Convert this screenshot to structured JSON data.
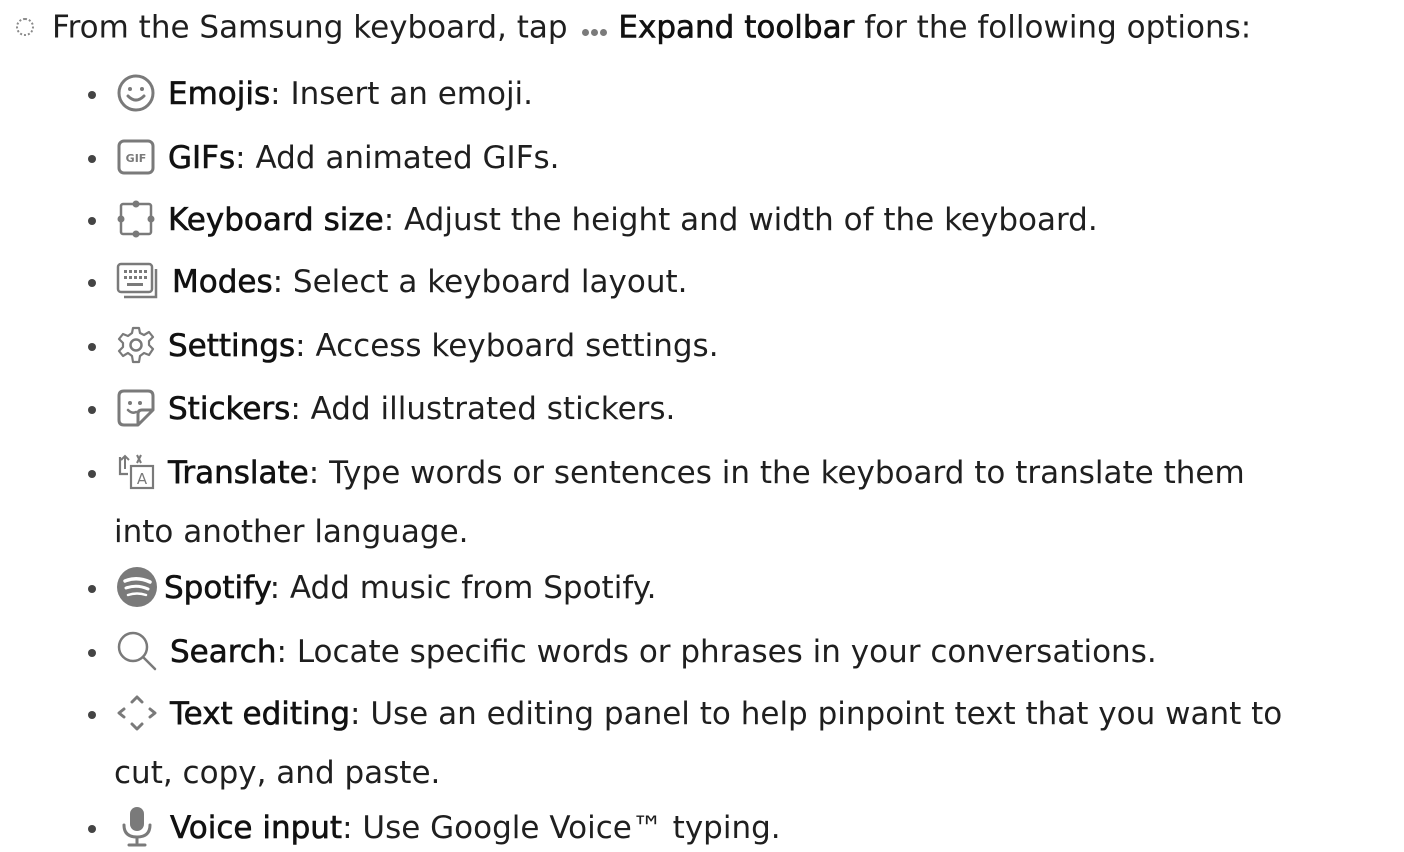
{
  "intro": {
    "prefix": "From the Samsung keyboard, tap",
    "action": "Expand toolbar",
    "suffix": "for the following options:"
  },
  "items": [
    {
      "icon": "emoji-icon",
      "label": "Emojis",
      "desc": ": Insert an emoji."
    },
    {
      "icon": "gif-icon",
      "label": "GIFs",
      "desc": ": Add animated GIFs."
    },
    {
      "icon": "keyboard-size-icon",
      "label": "Keyboard size",
      "desc": ": Adjust the height and width of the keyboard."
    },
    {
      "icon": "keyboard-modes-icon",
      "label": "Modes",
      "desc": ": Select a keyboard layout."
    },
    {
      "icon": "gear-icon",
      "label": "Settings",
      "desc": ": Access keyboard settings."
    },
    {
      "icon": "sticker-icon",
      "label": "Stickers",
      "desc": ": Add illustrated stickers."
    },
    {
      "icon": "translate-icon",
      "label": "Translate",
      "desc": ": Type words or sentences in the keyboard to translate them",
      "desc2": "into another language."
    },
    {
      "icon": "spotify-icon",
      "label": "Spotify",
      "desc": ": Add music from Spotify."
    },
    {
      "icon": "search-icon",
      "label": "Search",
      "desc": ": Locate specific words or phrases in your conversations."
    },
    {
      "icon": "text-editing-icon",
      "label": "Text editing",
      "desc": ": Use an editing panel to help pinpoint text that you want to",
      "desc2": "cut, copy, and paste."
    },
    {
      "icon": "microphone-icon",
      "label": "Voice input",
      "desc": ": Use Google Voice™ typing."
    }
  ]
}
